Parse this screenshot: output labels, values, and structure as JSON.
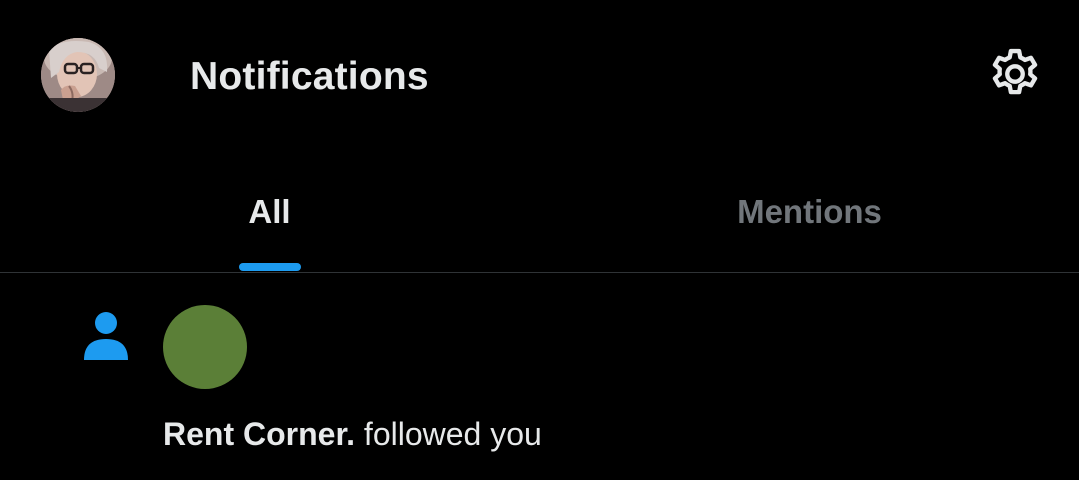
{
  "header": {
    "title": "Notifications",
    "avatar_icon": "user-avatar-photo",
    "settings_icon": "gear-icon"
  },
  "tabs": [
    {
      "label": "All",
      "selected": true
    },
    {
      "label": "Mentions",
      "selected": false
    }
  ],
  "notifications": [
    {
      "type_icon": "person-icon",
      "name": "Rent Corner.",
      "action": " followed you",
      "avatar_color": "#5b7f37"
    }
  ],
  "colors": {
    "background": "#000000",
    "accent": "#1d9bf0",
    "text_primary": "#e7e9ea",
    "text_secondary": "#71767b",
    "divider": "#2f3336"
  }
}
